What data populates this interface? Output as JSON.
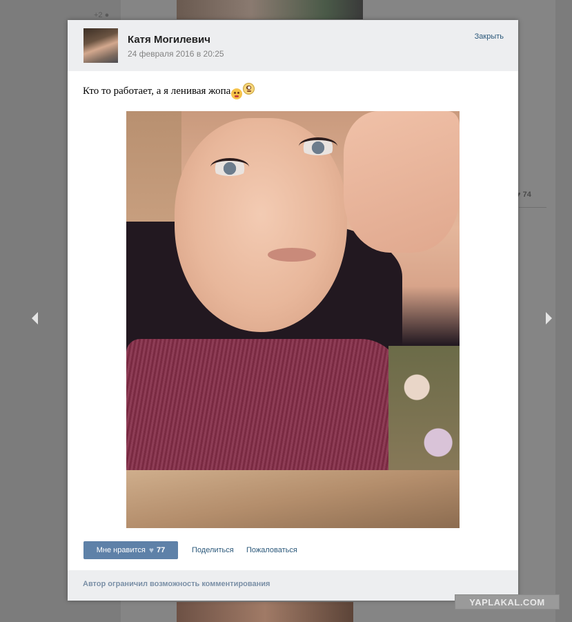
{
  "background": {
    "top_count": "+2",
    "right_count": "74"
  },
  "post": {
    "author": "Катя Могилевич",
    "date": "24 февраля 2016 в 20:25",
    "close_label": "Закрыть",
    "text": "Кто то работает, а я ленивая жопа",
    "emojis": [
      "angry-face-emoji",
      "flushed-face-emoji"
    ]
  },
  "actions": {
    "like_label": "Мне нравится",
    "like_count": "77",
    "share_label": "Поделиться",
    "report_label": "Пожаловаться"
  },
  "footer": {
    "comments_note": "Автор ограничил возможность комментирования"
  },
  "watermark": "YAPLAKAL.COM",
  "colors": {
    "overlay": "#7c7c7c",
    "header_bg": "#edeef0",
    "link": "#2b587a",
    "like_button": "#5e81a8"
  },
  "icons": {
    "prev": "chevron-left-icon",
    "next": "chevron-right-icon",
    "like": "heart-icon"
  }
}
